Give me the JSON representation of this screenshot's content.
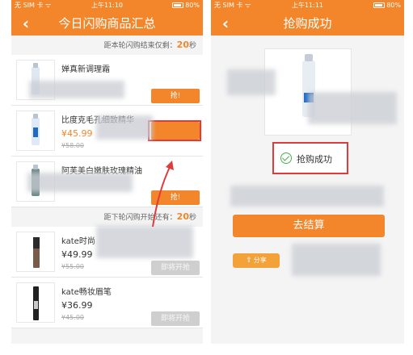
{
  "left_screen": {
    "status": {
      "carrier": "无 SIM 卡 ᯤ",
      "time": "上午11:10",
      "battery": "80%"
    },
    "title": "今日闪购商品汇总",
    "back_icon": "chevron-left-icon",
    "countdown_end": {
      "prefix": "距本轮闪购结束仅剩：",
      "value": "20",
      "suffix": "秒"
    },
    "items_current": [
      {
        "name": "婵真新调理霜",
        "price": "",
        "old_price": "",
        "button": "抢!"
      },
      {
        "name": "比度克毛孔细致精华",
        "price": "¥45.99",
        "old_price": "¥58.00",
        "button": ""
      },
      {
        "name": "阿芙美白嫩肤玫瑰精油",
        "price": "",
        "old_price": "",
        "button": "抢!"
      }
    ],
    "countdown_start": {
      "prefix": "距下轮闪购开始还有：",
      "value": "20",
      "suffix": "秒"
    },
    "items_next": [
      {
        "name": "kate时尚",
        "price": "¥49.99",
        "old_price": "¥55.00",
        "button": "即将开抢"
      },
      {
        "name": "kate畅妆眉笔",
        "price": "¥36.99",
        "old_price": "¥45.00",
        "button": "即将开抢"
      }
    ]
  },
  "right_screen": {
    "status": {
      "carrier": "无 SIM 卡 ᯤ",
      "time": "上午11:11",
      "battery": "80%"
    },
    "title": "抢购成功",
    "back_icon": "chevron-left-icon",
    "success_text": "抢购成功",
    "checkout_button": "去结算",
    "share_button": "分享"
  },
  "colors": {
    "accent": "#f3862a",
    "highlight": "#e03a3a",
    "success": "#4caf50"
  }
}
